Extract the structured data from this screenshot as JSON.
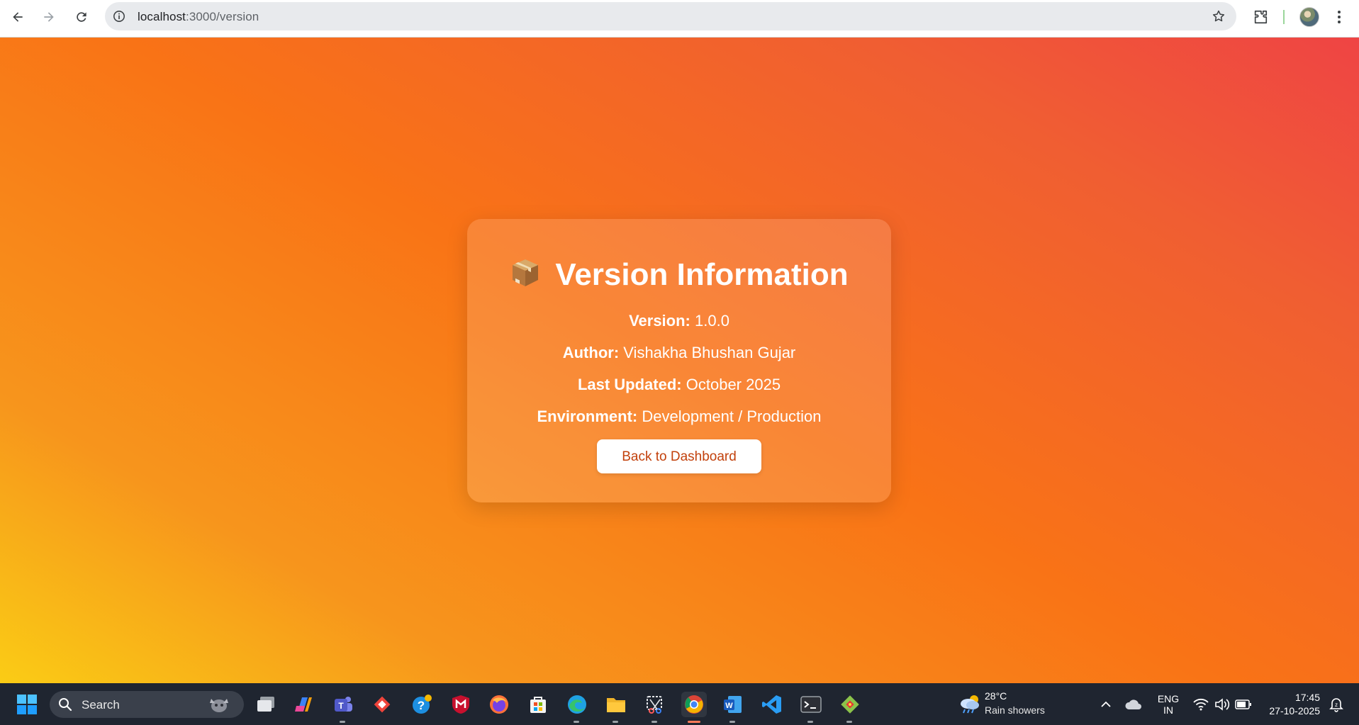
{
  "browser": {
    "url_host": "localhost",
    "url_path": ":3000/version"
  },
  "card": {
    "title": "Version Information",
    "rows": [
      {
        "label": "Version:",
        "value": "1.0.0"
      },
      {
        "label": "Author:",
        "value": "Vishakha Bhushan Gujar"
      },
      {
        "label": "Last Updated:",
        "value": "October 2025"
      },
      {
        "label": "Environment:",
        "value": "Development / Production"
      }
    ],
    "button_label": "Back to Dashboard"
  },
  "taskbar": {
    "search_label": "Search",
    "weather_temp": "28°C",
    "weather_desc": "Rain showers",
    "lang_top": "ENG",
    "lang_bottom": "IN",
    "time": "17:45",
    "date": "27-10-2025"
  },
  "colors": {
    "gradient_start": "#facc15",
    "gradient_mid": "#f97316",
    "gradient_end": "#ef4444",
    "button_text": "#c2410c"
  }
}
